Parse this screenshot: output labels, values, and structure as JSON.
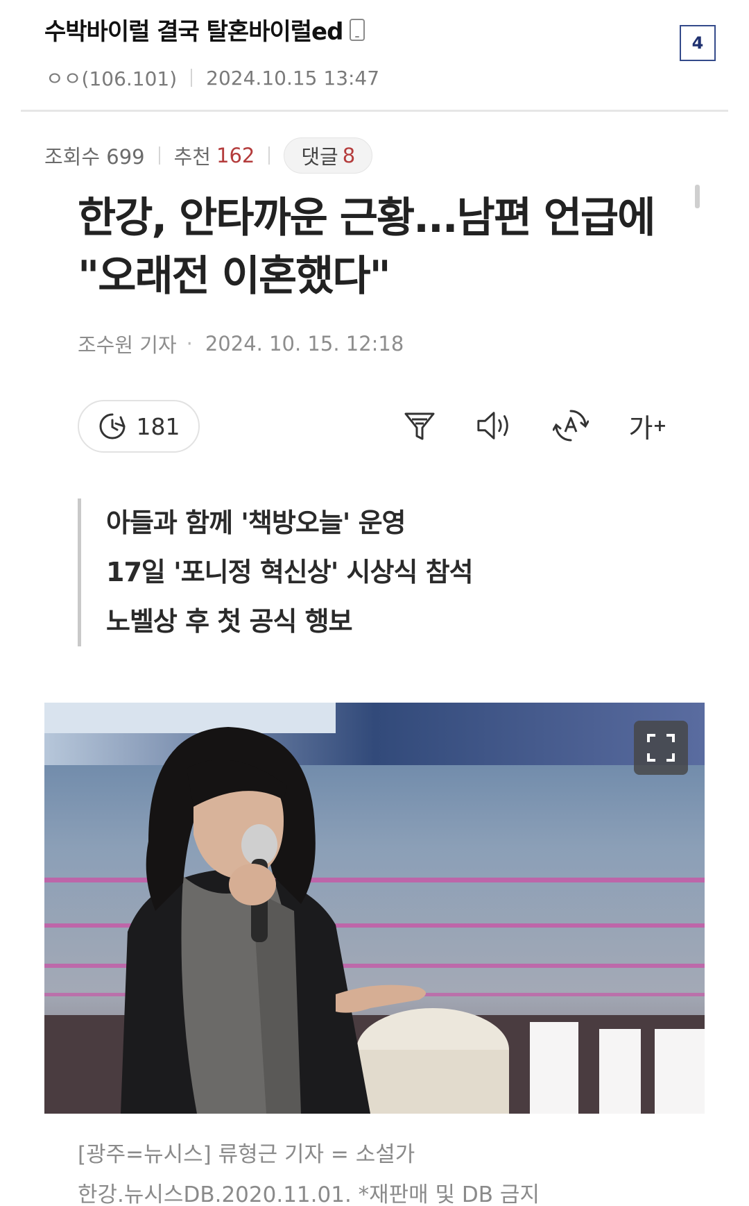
{
  "post": {
    "title": "수박바이럴 결국 탈혼바이럴ed",
    "author": "ㅇㅇ(106.101)",
    "datetime": "2024.10.15 13:47",
    "comment_box": "4"
  },
  "stats": {
    "views_label": "조회수 699",
    "recommend_label": "추천",
    "recommend_value": "162",
    "reply_label": "댓글",
    "reply_value": "8"
  },
  "article": {
    "headline_line1": "한강, 안타까운 근황...남편 언급에",
    "headline_line2": "\"오래전 이혼했다\"",
    "reporter": "조수원 기자",
    "dot": "·",
    "datetime": "2024. 10. 15. 12:18",
    "read_time": "181",
    "font_size_label": "가",
    "font_size_plus": "+",
    "summary": [
      "아들과 함께 '책방오늘' 운영",
      "17일 '포니정 혁신상' 시상식 참석",
      "노벨상 후 첫 공식 행보"
    ],
    "caption_line1": "[광주=뉴시스] 류형근 기자 = 소설가",
    "caption_line2": "한강.뉴시스DB.2020.11.01. *재판매 및 DB 금지"
  },
  "icons": {
    "phone": "mobile-phone-icon",
    "clock": "clock-icon",
    "summary": "summary-filter-icon",
    "speaker": "speaker-icon",
    "translate": "translate-icon",
    "expand": "expand-icon"
  },
  "colors": {
    "accent_red": "#b43c3c",
    "comment_box_border": "#334a8a"
  }
}
